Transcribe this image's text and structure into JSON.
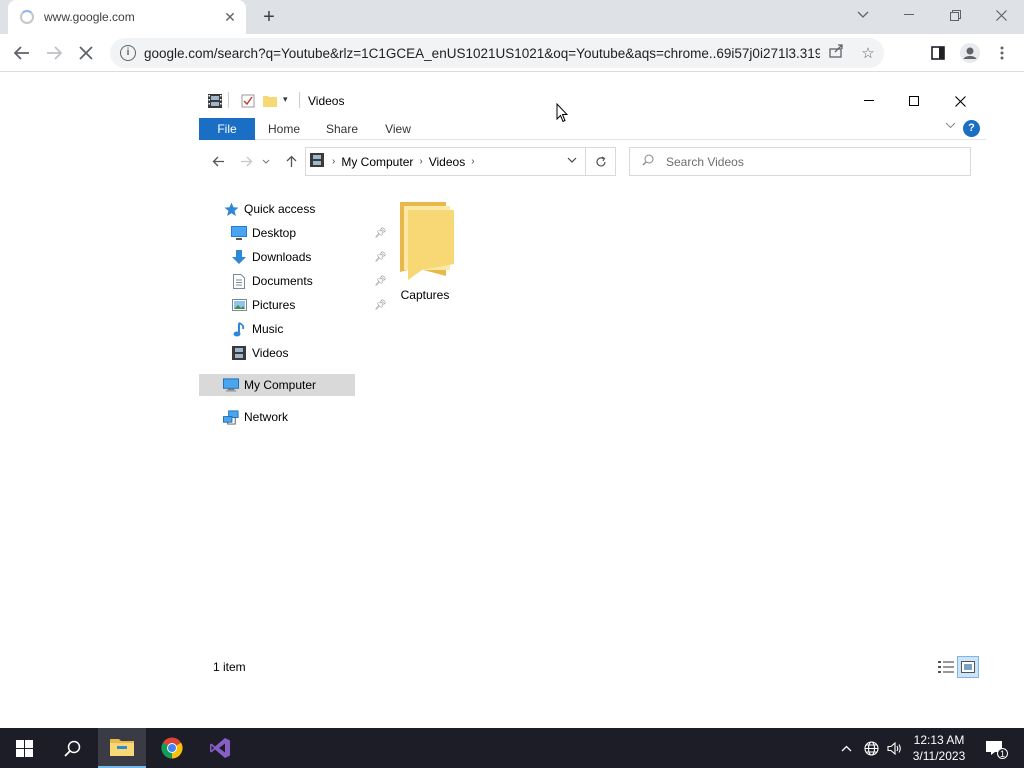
{
  "browser": {
    "tab_title": "www.google.com",
    "url": "google.com/search?q=Youtube&rlz=1C1GCEA_enUS1021US1021&oq=Youtube&aqs=chrome..69i57j0i271l3.319..."
  },
  "explorer": {
    "title": "Videos",
    "ribbon_tabs": [
      "File",
      "Home",
      "Share",
      "View"
    ],
    "help_label": "?",
    "breadcrumb": [
      "My Computer",
      "Videos"
    ],
    "search_placeholder": "Search Videos",
    "nav": {
      "quick_access": "Quick access",
      "items": [
        {
          "label": "Desktop",
          "icon": "desktop-icon",
          "pinned": true
        },
        {
          "label": "Downloads",
          "icon": "downloads-icon",
          "pinned": true
        },
        {
          "label": "Documents",
          "icon": "documents-icon",
          "pinned": true
        },
        {
          "label": "Pictures",
          "icon": "pictures-icon",
          "pinned": true
        },
        {
          "label": "Music",
          "icon": "music-icon",
          "pinned": false
        },
        {
          "label": "Videos",
          "icon": "videos-icon",
          "pinned": false
        }
      ],
      "my_computer": "My Computer",
      "network": "Network"
    },
    "files": [
      {
        "name": "Captures",
        "type": "folder"
      }
    ],
    "status": "1 item"
  },
  "taskbar": {
    "time": "12:13 AM",
    "date": "3/11/2023",
    "notification_count": "1"
  },
  "colors": {
    "accent": "#1a6fc4",
    "taskbar": "#1c1d26",
    "folder": "#f8d775"
  }
}
